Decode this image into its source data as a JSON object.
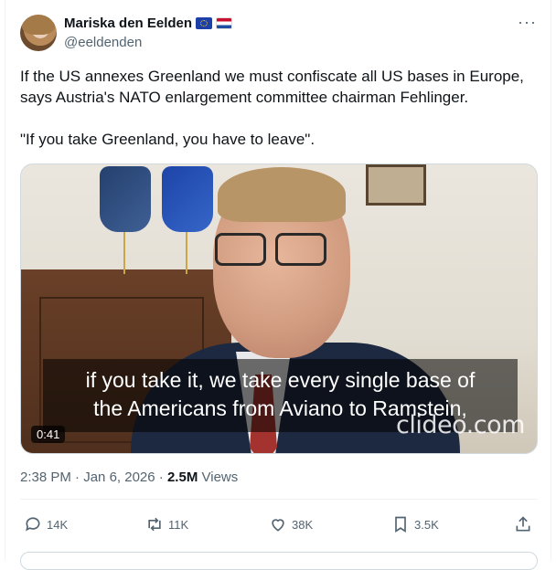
{
  "author": {
    "name": "Mariska den Eelden",
    "handle": "@eeldenden",
    "flags": [
      "eu-flag-icon",
      "netherlands-flag-icon"
    ]
  },
  "post": {
    "text_paragraph_1": "If the US annexes Greenland we must confiscate all US bases in Europe, says Austria's NATO enlargement committee chairman Fehlinger.",
    "text_paragraph_2": "\"If you take Greenland, you have to leave\"."
  },
  "video": {
    "subtitle_line_1": "if you take it, we take every single base of",
    "subtitle_line_2": "the Americans from Aviano to Ramstein,",
    "watermark": "clideo.com",
    "duration": "0:41"
  },
  "meta": {
    "time": "2:38 PM",
    "separator": "·",
    "date": "Jan 6, 2026",
    "views_count": "2.5M",
    "views_label": "Views"
  },
  "actions": {
    "replies": "14K",
    "reposts": "11K",
    "likes": "38K",
    "bookmarks": "3.5K"
  },
  "more_label": "···",
  "colors": {
    "text": "#0f1419",
    "secondary": "#536471",
    "border": "#cfd9de"
  }
}
